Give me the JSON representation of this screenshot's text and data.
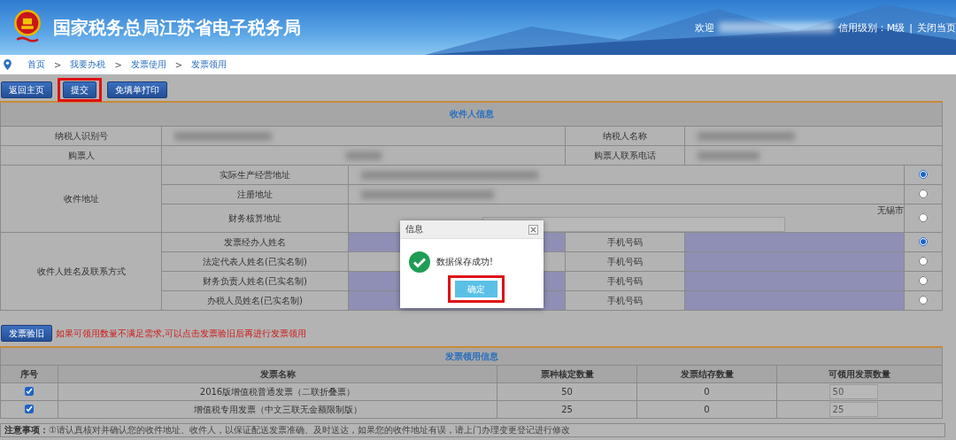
{
  "header": {
    "title": "国家税务总局江苏省电子税务局",
    "welcome": "欢迎",
    "credit": "信用级别：M级",
    "separator": "|",
    "close": "关闭当页"
  },
  "breadcrumb": [
    "首页",
    "我要办税",
    "发票使用",
    "发票领用"
  ],
  "breadcrumb_separator": ">",
  "toolbar": [
    {
      "label": "返回主页",
      "highlighted": false
    },
    {
      "label": "提交",
      "highlighted": true
    },
    {
      "label": "免填单打印",
      "highlighted": false
    }
  ],
  "recipient": {
    "title": "收件人信息",
    "taxpayer_id_label": "纳税人识别号",
    "taxpayer_name_label": "纳税人名称",
    "buyer_label": "购票人",
    "buyer_phone_label": "购票人联系电话",
    "address_label": "收件地址",
    "addresses": [
      {
        "label": "实际生产经营地址",
        "selected": true
      },
      {
        "label": "注册地址",
        "selected": false
      },
      {
        "label": "财务核算地址",
        "city": "无锡市",
        "selected": false
      }
    ],
    "contact_label": "收件人姓名及联系方式",
    "contacts": [
      {
        "label": "发票经办人姓名",
        "phone_label": "手机号码",
        "name_highlighted": true,
        "selected": true
      },
      {
        "label": "法定代表人姓名(已实名制)",
        "phone_label": "手机号码",
        "name_highlighted": false,
        "selected": false
      },
      {
        "label": "财务负责人姓名(已实名制)",
        "phone_label": "手机号码",
        "name_highlighted": true,
        "selected": false
      },
      {
        "label": "办税人员姓名(已实名制)",
        "phone_label": "手机号码",
        "name_highlighted": true,
        "selected": false
      }
    ]
  },
  "verify_button": "发票验旧",
  "hint": "如果可领用数量不满足需求,可以点击发票验旧后再进行发票领用",
  "invoices": {
    "title": "发票领用信息",
    "columns": [
      "序号",
      "发票名称",
      "票种核定数量",
      "发票结存数量",
      "可领用发票数量"
    ],
    "rows": [
      {
        "checked": true,
        "name": "2016版增值税普通发票（二联折叠票）",
        "approved": "50",
        "stock": "0",
        "available": "50"
      },
      {
        "checked": true,
        "name": "增值税专用发票（中文三联无金额限制版）",
        "approved": "25",
        "stock": "0",
        "available": "25"
      }
    ]
  },
  "notice": {
    "label": "注意事项：",
    "text": "①请认真核对并确认您的收件地址、收件人，以保证配送发票准确、及时送达，如果您的收件地址有误，请上门办理变更登记进行修改"
  },
  "dialog": {
    "title": "信息",
    "message": "数据保存成功!",
    "confirm": "确定",
    "confirm_highlighted": true
  }
}
